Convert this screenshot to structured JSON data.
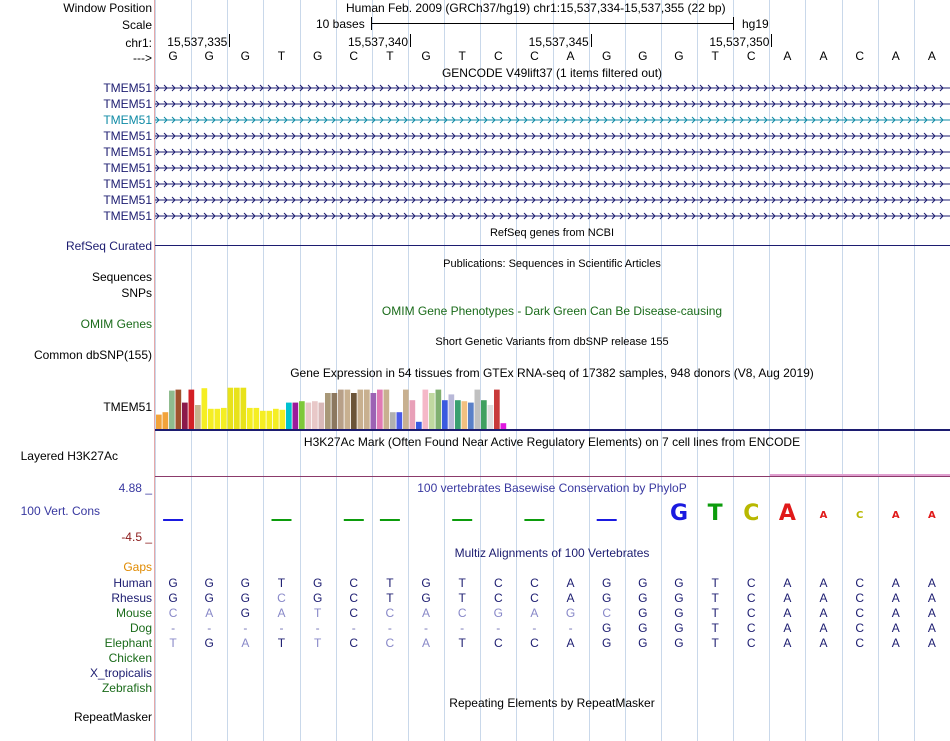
{
  "header": {
    "window_position_label": "Window Position",
    "window_position_value": "Human Feb. 2009 (GRCh37/hg19)   chr1:15,537,334-15,537,355 (22 bp)",
    "scale_label": "Scale",
    "scale_text": "10 bases",
    "scale_assembly": "hg19",
    "chrom_label": "chr1:",
    "strand_label": "--->",
    "positions": [
      "15,537,335",
      "15,537,340",
      "15,537,345",
      "15,537,350"
    ],
    "bases": [
      "G",
      "G",
      "G",
      "T",
      "G",
      "C",
      "T",
      "G",
      "T",
      "C",
      "C",
      "A",
      "G",
      "G",
      "G",
      "T",
      "C",
      "A",
      "A",
      "C",
      "A",
      "A"
    ]
  },
  "tracks": {
    "gencode": {
      "title": "GENCODE V49lift37 (1 items filtered out)",
      "rows": [
        {
          "label": "TMEM51",
          "color": "#1c1c70"
        },
        {
          "label": "TMEM51",
          "color": "#1c1c70"
        },
        {
          "label": "TMEM51",
          "color": "#0e8aa5"
        },
        {
          "label": "TMEM51",
          "color": "#1c1c70"
        },
        {
          "label": "TMEM51",
          "color": "#1c1c70"
        },
        {
          "label": "TMEM51",
          "color": "#1c1c70"
        },
        {
          "label": "TMEM51",
          "color": "#1c1c70"
        },
        {
          "label": "TMEM51",
          "color": "#1c1c70"
        },
        {
          "label": "TMEM51",
          "color": "#1c1c70"
        }
      ]
    },
    "refseq": {
      "title": "RefSeq genes from NCBI",
      "label": "RefSeq Curated",
      "color": "#1c1c70"
    },
    "publications": {
      "title": "Publications: Sequences in Scientific Articles",
      "label": "Sequences"
    },
    "snps": {
      "label": "SNPs"
    },
    "omim": {
      "title": "OMIM Gene Phenotypes - Dark Green Can Be Disease-causing",
      "label": "OMIM Genes",
      "color": "#1a6b1a"
    },
    "dbsnp": {
      "title": "Short Genetic Variants from dbSNP release 155",
      "label": "Common dbSNP(155)"
    },
    "gtex": {
      "title": "Gene Expression in 54 tissues from GTEx RNA-seq of 17382 samples, 948 donors (V8, Aug 2019)",
      "label": "TMEM51",
      "bars": [
        0.3,
        0.35,
        0.8,
        0.82,
        0.55,
        0.82,
        0.5,
        0.85,
        0.42,
        0.42,
        0.44,
        0.86,
        0.86,
        0.86,
        0.44,
        0.44,
        0.38,
        0.38,
        0.42,
        0.4,
        0.55,
        0.55,
        0.58,
        0.55,
        0.58,
        0.55,
        0.75,
        0.75,
        0.82,
        0.82,
        0.75,
        0.82,
        0.82,
        0.75,
        0.82,
        0.82,
        0.35,
        0.35,
        0.82,
        0.6,
        0.15,
        0.82,
        0.75,
        0.82,
        0.6,
        0.72,
        0.6,
        0.58,
        0.55,
        0.82,
        0.6,
        0.5,
        0.82,
        0.12
      ],
      "colors": [
        "#f2a33a",
        "#f2a33a",
        "#8fbc8f",
        "#a0522d",
        "#8b1a4a",
        "#d31f26",
        "#c5b48f",
        "#f5ee23",
        "#f5ee23",
        "#f5ee23",
        "#f5ee23",
        "#e8e21a",
        "#e8e21a",
        "#e8e21a",
        "#f5ee23",
        "#f5ee23",
        "#f5ee23",
        "#f5ee23",
        "#f5ee23",
        "#f5ee23",
        "#00c2d0",
        "#9b1a9b",
        "#7ec83a",
        "#e8c8c8",
        "#e8c8c8",
        "#d8b8b8",
        "#a89878",
        "#8c7860",
        "#b8a088",
        "#c8b090",
        "#6b5438",
        "#c8b090",
        "#c8b090",
        "#9c62b4",
        "#e07ab4",
        "#c8b090",
        "#b0b0b0",
        "#4a5ae8",
        "#c8b090",
        "#e8a0b8",
        "#3a5ae0",
        "#f5b8c8",
        "#c0d8a0",
        "#80b070",
        "#3a5ae0",
        "#b8b8d8",
        "#3aa070",
        "#f2c080",
        "#5a80c8",
        "#c0c0c0",
        "#40a060",
        "#e0e0e0",
        "#c83a3a",
        "#e018e0"
      ]
    },
    "h3k27ac": {
      "title": "H3K27Ac Mark (Often Found Near Active Regulatory Elements) on 7 cell lines from ENCODE",
      "label": "Layered H3K27Ac"
    },
    "cons": {
      "title": "100 vertebrates Basewise Conservation by PhyloP",
      "label": "100 Vert. Cons",
      "max": "4.88 _",
      "min": "-4.5 _",
      "logo_bases": [
        "G",
        "T",
        "C",
        "A",
        "A",
        "C",
        "A",
        "A"
      ],
      "logo_colors": [
        "#1a1ae0",
        "#0c9c0c",
        "#b8b800",
        "#e01a1a",
        "#e01a1a",
        "#b8b800",
        "#e01a1a",
        "#e01a1a"
      ]
    },
    "multiz": {
      "title": "Multiz Alignments of 100 Vertebrates",
      "gaps_label": "Gaps",
      "species": [
        {
          "name": "Human",
          "color": "#1c1c70",
          "seq": [
            "G",
            "G",
            "G",
            "T",
            "G",
            "C",
            "T",
            "G",
            "T",
            "C",
            "C",
            "A",
            "G",
            "G",
            "G",
            "T",
            "C",
            "A",
            "A",
            "C",
            "A",
            "A"
          ]
        },
        {
          "name": "Rhesus",
          "color": "#1c1c70",
          "seq": [
            "G",
            "G",
            "G",
            "C",
            "G",
            "C",
            "T",
            "G",
            "T",
            "C",
            "C",
            "A",
            "G",
            "G",
            "G",
            "T",
            "C",
            "A",
            "A",
            "C",
            "A",
            "A"
          ]
        },
        {
          "name": "Mouse",
          "color": "#1a6b1a",
          "seq": [
            "C",
            "A",
            "G",
            "A",
            "T",
            "C",
            "C",
            "A",
            "C",
            "G",
            "A",
            "G",
            "C",
            "G",
            "G",
            "T",
            "C",
            "A",
            "A",
            "C",
            "A",
            "A"
          ]
        },
        {
          "name": "Dog",
          "color": "#1a6b1a",
          "seq": [
            "-",
            "-",
            "-",
            "-",
            "-",
            "-",
            "-",
            "-",
            "-",
            "-",
            "-",
            "-",
            "G",
            "G",
            "G",
            "T",
            "C",
            "A",
            "A",
            "C",
            "A",
            "A"
          ]
        },
        {
          "name": "Elephant",
          "color": "#1a6b1a",
          "seq": [
            "T",
            "G",
            "A",
            "T",
            "T",
            "C",
            "C",
            "A",
            "T",
            "C",
            "C",
            "A",
            "G",
            "G",
            "G",
            "T",
            "C",
            "A",
            "A",
            "C",
            "A",
            "A"
          ]
        },
        {
          "name": "Chicken",
          "color": "#1a6b1a",
          "seq": []
        },
        {
          "name": "X_tropicalis",
          "color": "#1c1c70",
          "seq": []
        },
        {
          "name": "Zebrafish",
          "color": "#1a6b1a",
          "seq": []
        }
      ]
    },
    "repeatmasker": {
      "title": "Repeating Elements by RepeatMasker",
      "label": "RepeatMasker"
    }
  }
}
